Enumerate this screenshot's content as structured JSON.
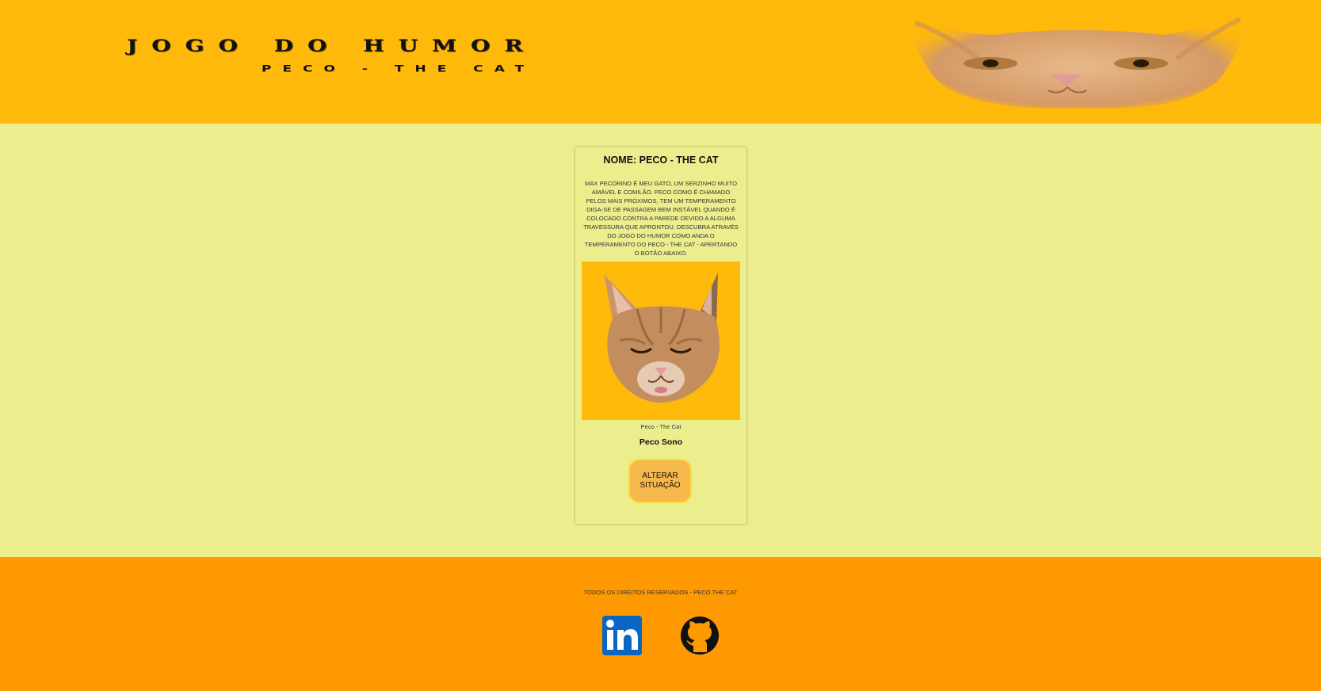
{
  "header": {
    "title": "JOGO DO HUMOR",
    "subtitle": "PECO - THE CAT",
    "logo_icon": "cat-face-icon"
  },
  "card": {
    "name": "NOME: PECO - THE CAT",
    "description": "Max Pecorino é meu gato, um serzinho muito amável e comilão. Peco como é chamado pelos mais próximos, tem um temperamento diga-se de passagem bem instável quando é colocado contra a parede devido a alguma travessura que aprontou. Descubra através do Jogo do Humor como anda o temperamento do Peco - The Cat - apertando o botão abaixo.",
    "photo_icon": "sleeping-cat-icon",
    "caption": "Peco - The Cat",
    "status": "Peco Sono",
    "button_label": "ALTERAR SITUAÇÃO"
  },
  "footer": {
    "copyright": "TODOS OS DIREITOS RESERVADOS - PECO THE CAT",
    "social": [
      {
        "icon": "linkedin-icon",
        "color": "#0a66c2"
      },
      {
        "icon": "github-icon",
        "color": "#111111"
      }
    ]
  },
  "colors": {
    "header_bg": "#ffb90a",
    "body_bg": "#ecee8e",
    "footer_bg": "#ff9902",
    "button_bg": "#f6b84a",
    "button_border": "#f7dc34"
  }
}
